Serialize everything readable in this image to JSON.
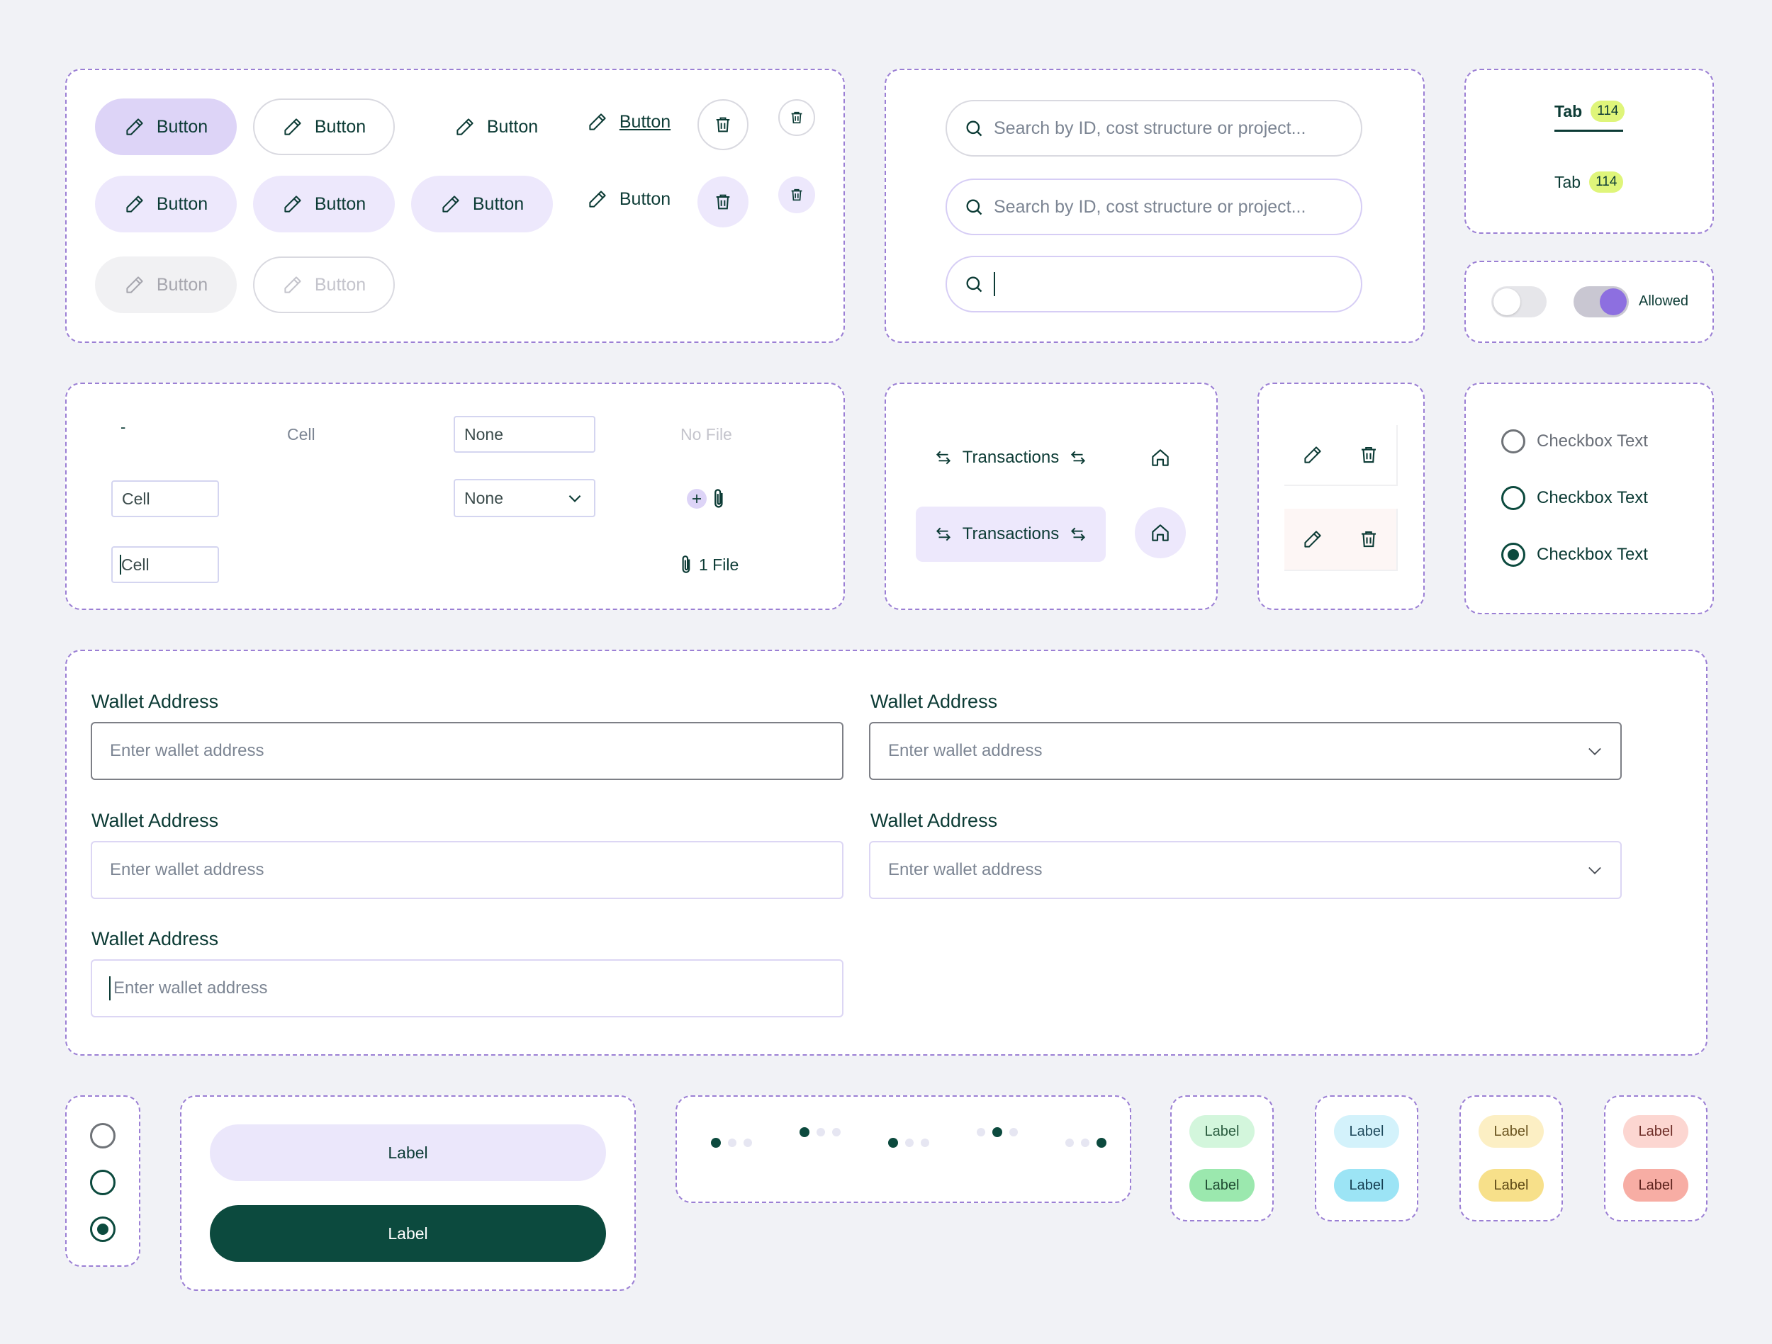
{
  "buttons": {
    "label": "Button",
    "icons": {
      "edit": "pencil-icon",
      "delete": "trash-icon"
    }
  },
  "search": {
    "placeholder": "Search by ID, cost structure or project...",
    "icon": "search-icon"
  },
  "tabs": [
    {
      "label": "Tab",
      "count": "114",
      "active": true
    },
    {
      "label": "Tab",
      "count": "114",
      "active": false
    }
  ],
  "toggles": {
    "off_state": false,
    "on_state": true,
    "on_label": "Allowed"
  },
  "table_cells": {
    "dash": "-",
    "cell_text": "Cell",
    "select_value": "None",
    "dropdown_value": "None",
    "no_file": "No File",
    "cell_input_value": "Cell",
    "file_count": "1 File"
  },
  "nav": {
    "transactions_label": "Transactions"
  },
  "checkboxes": [
    {
      "label": "Checkbox Text",
      "state": "unchecked-disabled"
    },
    {
      "label": "Checkbox Text",
      "state": "unchecked"
    },
    {
      "label": "Checkbox Text",
      "state": "checked"
    }
  ],
  "wallet_fields": [
    {
      "label": "Wallet Address",
      "placeholder": "Enter wallet address",
      "variant": "default"
    },
    {
      "label": "Wallet Address",
      "placeholder": "Enter wallet address",
      "variant": "select-default"
    },
    {
      "label": "Wallet Address",
      "placeholder": "Enter wallet address",
      "variant": "light"
    },
    {
      "label": "Wallet Address",
      "placeholder": "Enter wallet address",
      "variant": "select-light"
    },
    {
      "label": "Wallet Address",
      "placeholder": "Enter wallet address",
      "variant": "focused"
    }
  ],
  "large_buttons": [
    {
      "label": "Label",
      "style": "soft"
    },
    {
      "label": "Label",
      "style": "dark"
    }
  ],
  "pagination": {
    "pages": 3,
    "active_positions": [
      1,
      2,
      3,
      4,
      5
    ]
  },
  "chips": {
    "label": "Label",
    "colors": {
      "green": [
        "#d3f6dc",
        "#9be8ae"
      ],
      "blue": [
        "#d3f2fb",
        "#9ce4f5"
      ],
      "yellow": [
        "#fcefc4",
        "#f7e08a"
      ],
      "red": [
        "#fcd6d1",
        "#f7ada4"
      ]
    }
  },
  "colors": {
    "accent": "#8d6fe0",
    "primary_dark": "#0c4a3e",
    "text": "#0c3b35",
    "panel_border": "#9b7fd4"
  }
}
